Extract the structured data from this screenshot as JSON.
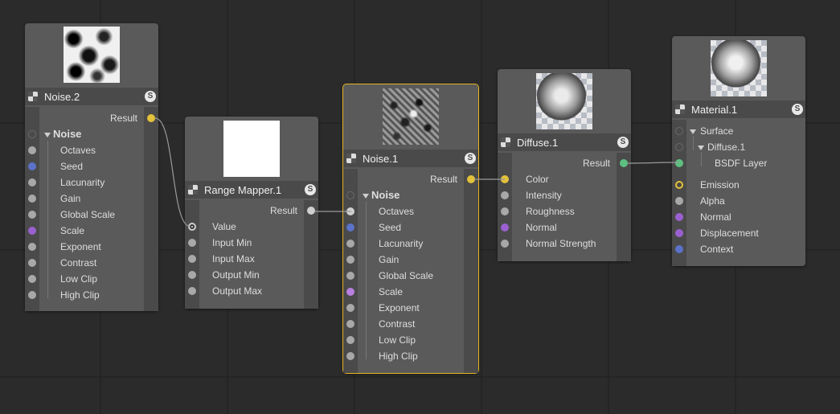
{
  "colors": {
    "background": "#2b2b2b",
    "node": "#5a5a5a",
    "selected_outline": "#e6b422",
    "port_yellow": "#e3c13b",
    "port_gray": "#a8a8a8",
    "port_blue": "#5a72c8",
    "port_purple": "#9a60d0",
    "port_green": "#5cc080",
    "wire": "#9a9a9a"
  },
  "nodes": {
    "noise2": {
      "title": "Noise.2",
      "badge": "S",
      "result_label": "Result",
      "group_label": "Noise",
      "params": [
        "Octaves",
        "Seed",
        "Lacunarity",
        "Gain",
        "Global Scale",
        "Scale",
        "Exponent",
        "Contrast",
        "Low Clip",
        "High Clip"
      ]
    },
    "range_mapper": {
      "title": "Range Mapper.1",
      "badge": "S",
      "result_label": "Result",
      "params": [
        "Value",
        "Input Min",
        "Input Max",
        "Output Min",
        "Output Max"
      ]
    },
    "noise1": {
      "title": "Noise.1",
      "badge": "S",
      "result_label": "Result",
      "group_label": "Noise",
      "params": [
        "Octaves",
        "Seed",
        "Lacunarity",
        "Gain",
        "Global Scale",
        "Scale",
        "Exponent",
        "Contrast",
        "Low Clip",
        "High Clip"
      ]
    },
    "diffuse": {
      "title": "Diffuse.1",
      "badge": "S",
      "result_label": "Result",
      "params": [
        "Color",
        "Intensity",
        "Roughness",
        "Normal",
        "Normal Strength"
      ]
    },
    "material": {
      "title": "Material.1",
      "badge": "S",
      "surface_label": "Surface",
      "diffuse_label": "Diffuse.1",
      "bsdf_label": "BSDF Layer",
      "params": [
        "Emission",
        "Alpha",
        "Normal",
        "Displacement",
        "Context"
      ]
    }
  }
}
